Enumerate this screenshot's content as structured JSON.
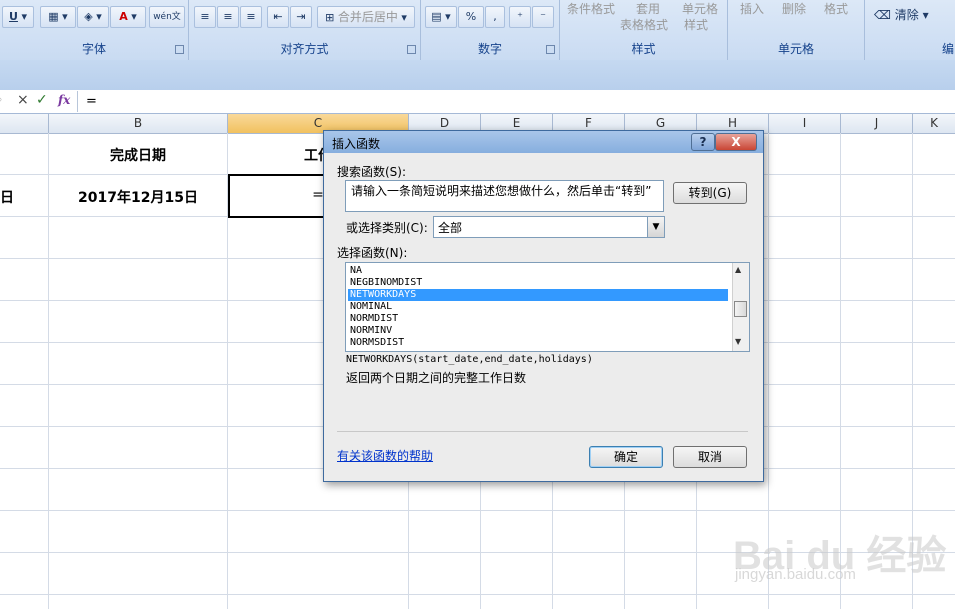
{
  "ribbon": {
    "groups": [
      {
        "label": "字体"
      },
      {
        "label": "对齐方式"
      },
      {
        "label": "数字"
      },
      {
        "label": "样式"
      },
      {
        "label": "单元格"
      },
      {
        "label": "编"
      }
    ],
    "underline_label": "U",
    "percent_label": "%",
    "merge_center_label": "合并后居中",
    "conditional_format_label": "条件格式",
    "apply_label": "套用",
    "table_format_label": "表格格式",
    "cell_label": "单元格",
    "style_label": "样式",
    "insert_label": "插入",
    "delete_label": "删除",
    "format_label": "格式",
    "clear_label": "清除",
    "wen_label": "wén文"
  },
  "formula_bar": {
    "fx_label": "fx",
    "value": "=",
    "cancel_icon": "×",
    "enter_icon": "✓"
  },
  "grid": {
    "columns": [
      "B",
      "C",
      "D",
      "E",
      "F",
      "G",
      "H",
      "I",
      "J",
      "K"
    ],
    "cells": {
      "b_header": "完成日期",
      "c_header": "工作",
      "a_value": "日",
      "b_value": "2017年12月15日",
      "c_value": "="
    }
  },
  "dialog": {
    "title": "插入函数",
    "help_btn": "?",
    "close_btn": "X",
    "search_label": "搜索函数(S):",
    "search_value": "请输入一条简短说明来描述您想做什么，然后单击“转到”",
    "goto_button": "转到(G)",
    "category_label": "或选择类别(C):",
    "category_value": "全部",
    "select_label": "选择函数(N):",
    "functions": [
      "NA",
      "NEGBINOMDIST",
      "NETWORKDAYS",
      "NOMINAL",
      "NORMDIST",
      "NORMINV",
      "NORMSDIST"
    ],
    "selected_index": 2,
    "signature": "NETWORKDAYS(start_date,end_date,holidays)",
    "description": "返回两个日期之间的完整工作日数",
    "help_link": "有关该函数的帮助",
    "ok_button": "确定",
    "cancel_button": "取消"
  },
  "watermark": {
    "logo": "Bai du 经验",
    "url": "jingyan.baidu.com"
  }
}
